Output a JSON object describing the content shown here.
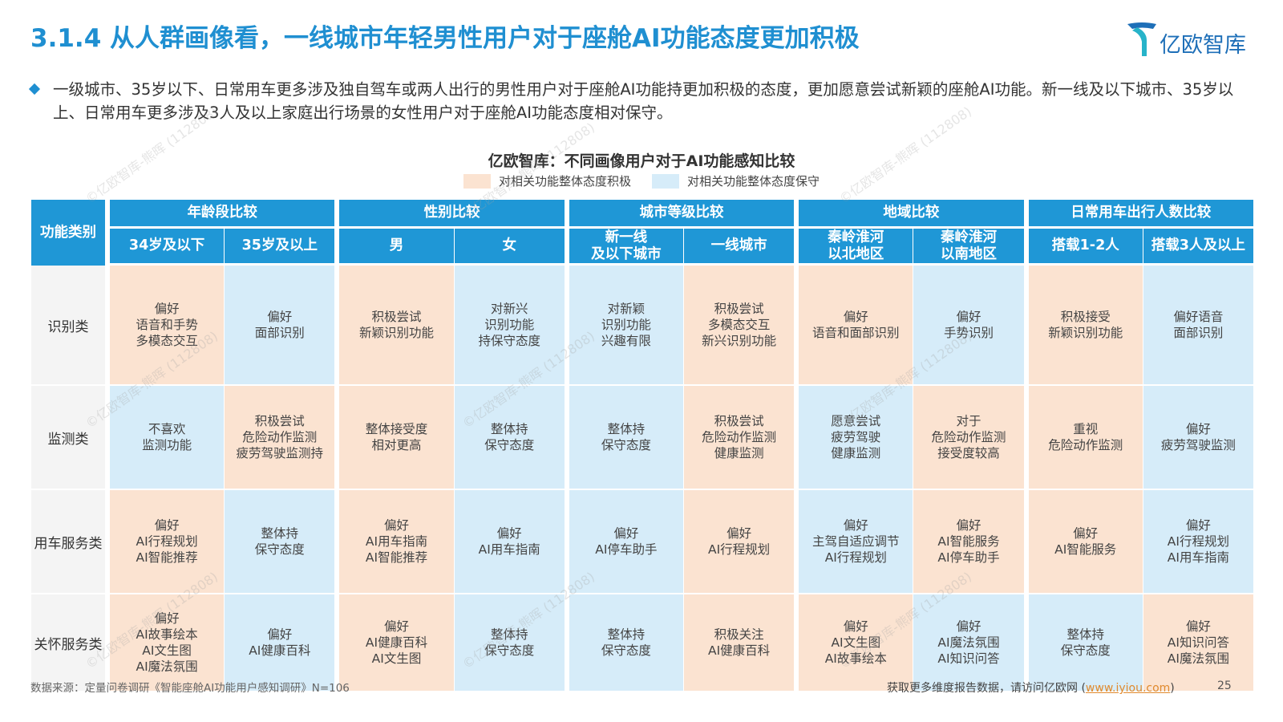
{
  "title": "3.1.4 从人群画像看，一线城市年轻男性用户对于座舱AI功能态度更加积极",
  "brand": {
    "name": "亿欧智库"
  },
  "bullet": "一级城市、35岁以下、日常用车更多涉及独自驾车或两人出行的男性用户对于座舱AI功能持更加积极的态度，更加愿意尝试新颖的座舱AI功能。新一线及以下城市、35岁以上、日常用车更多涉及3人及以上家庭出行场景的女性用户对于座舱AI功能态度相对保守。",
  "chart_title": "亿欧智库：不同画像用户对于AI功能感知比较",
  "legend": [
    {
      "label": "对相关功能整体态度积极",
      "color": "#fbe3d1"
    },
    {
      "label": "对相关功能整体态度保守",
      "color": "#d6ecf9"
    }
  ],
  "table": {
    "corner": "功能类别",
    "groups": [
      "年龄段比较",
      "性别比较",
      "城市等级比较",
      "地域比较",
      "日常用车出行人数比较"
    ],
    "subs": [
      "34岁及以下",
      "35岁及以上",
      "男",
      "女",
      "新一线\n及以下城市",
      "一线城市",
      "秦岭淮河\n以北地区",
      "秦岭淮河\n以南地区",
      "搭载1-2人",
      "搭载3人及以上"
    ],
    "rows": [
      {
        "label": "识别类",
        "cells": [
          {
            "text": "偏好\n语音和手势\n多模态交互",
            "attitude": "积极"
          },
          {
            "text": "偏好\n面部识别",
            "attitude": "保守"
          },
          {
            "text": "积极尝试\n新颖识别功能",
            "attitude": "积极"
          },
          {
            "text": "对新兴\n识别功能\n持保守态度",
            "attitude": "保守"
          },
          {
            "text": "对新颖\n识别功能\n兴趣有限",
            "attitude": "保守"
          },
          {
            "text": "积极尝试\n多模态交互\n新兴识别功能",
            "attitude": "积极"
          },
          {
            "text": "偏好\n语音和面部识别",
            "attitude": "积极"
          },
          {
            "text": "偏好\n手势识别",
            "attitude": "保守"
          },
          {
            "text": "积极接受\n新颖识别功能",
            "attitude": "积极"
          },
          {
            "text": "偏好语音\n面部识别",
            "attitude": "保守"
          }
        ]
      },
      {
        "label": "监测类",
        "cells": [
          {
            "text": "不喜欢\n监测功能",
            "attitude": "保守"
          },
          {
            "text": "积极尝试\n危险动作监测\n疲劳驾驶监测持",
            "attitude": "积极"
          },
          {
            "text": "整体接受度\n相对更高",
            "attitude": "积极"
          },
          {
            "text": "整体持\n保守态度",
            "attitude": "保守"
          },
          {
            "text": "整体持\n保守态度",
            "attitude": "保守"
          },
          {
            "text": "积极尝试\n危险动作监测\n健康监测",
            "attitude": "积极"
          },
          {
            "text": "愿意尝试\n疲劳驾驶\n健康监测",
            "attitude": "保守"
          },
          {
            "text": "对于\n危险动作监测\n接受度较高",
            "attitude": "积极"
          },
          {
            "text": "重视\n危险动作监测",
            "attitude": "积极"
          },
          {
            "text": "偏好\n疲劳驾驶监测",
            "attitude": "保守"
          }
        ]
      },
      {
        "label": "用车服务类",
        "cells": [
          {
            "text": "偏好\nAI行程规划\nAI智能推荐",
            "attitude": "积极"
          },
          {
            "text": "整体持\n保守态度",
            "attitude": "保守"
          },
          {
            "text": "偏好\nAI用车指南\nAI智能推荐",
            "attitude": "积极"
          },
          {
            "text": "偏好\nAI用车指南",
            "attitude": "保守"
          },
          {
            "text": "偏好\nAI停车助手",
            "attitude": "保守"
          },
          {
            "text": "偏好\nAI行程规划",
            "attitude": "积极"
          },
          {
            "text": "偏好\n主驾自适应调节\nAI行程规划",
            "attitude": "保守"
          },
          {
            "text": "偏好\nAI智能服务\nAI停车助手",
            "attitude": "积极"
          },
          {
            "text": "偏好\nAI智能服务",
            "attitude": "积极"
          },
          {
            "text": "偏好\nAI行程规划\nAI用车指南",
            "attitude": "保守"
          }
        ]
      },
      {
        "label": "关怀服务类",
        "cells": [
          {
            "text": "偏好\nAI故事绘本\nAI文生图\nAI魔法氛围",
            "attitude": "积极"
          },
          {
            "text": "偏好\nAI健康百科",
            "attitude": "保守"
          },
          {
            "text": "偏好\nAI健康百科\nAI文生图",
            "attitude": "积极"
          },
          {
            "text": "整体持\n保守态度",
            "attitude": "保守"
          },
          {
            "text": "整体持\n保守态度",
            "attitude": "保守"
          },
          {
            "text": "积极关注\nAI健康百科",
            "attitude": "积极"
          },
          {
            "text": "偏好\nAI文生图\nAI故事绘本",
            "attitude": "积极"
          },
          {
            "text": "偏好\nAI魔法氛围\nAI知识问答",
            "attitude": "保守"
          },
          {
            "text": "整体持\n保守态度",
            "attitude": "保守"
          },
          {
            "text": "偏好\nAI知识问答\nAI魔法氛围",
            "attitude": "积极"
          }
        ]
      }
    ]
  },
  "source": "数据来源：定量问卷调研《智能座舱AI功能用户感知调研》N=106",
  "footer": {
    "text": "获取更多维度报告数据，请访问亿欧网 (",
    "link": "www.iyiou.com",
    "close": ")"
  },
  "page_number": "25",
  "watermark": "©亿欧智库-熊晖 (112808)"
}
